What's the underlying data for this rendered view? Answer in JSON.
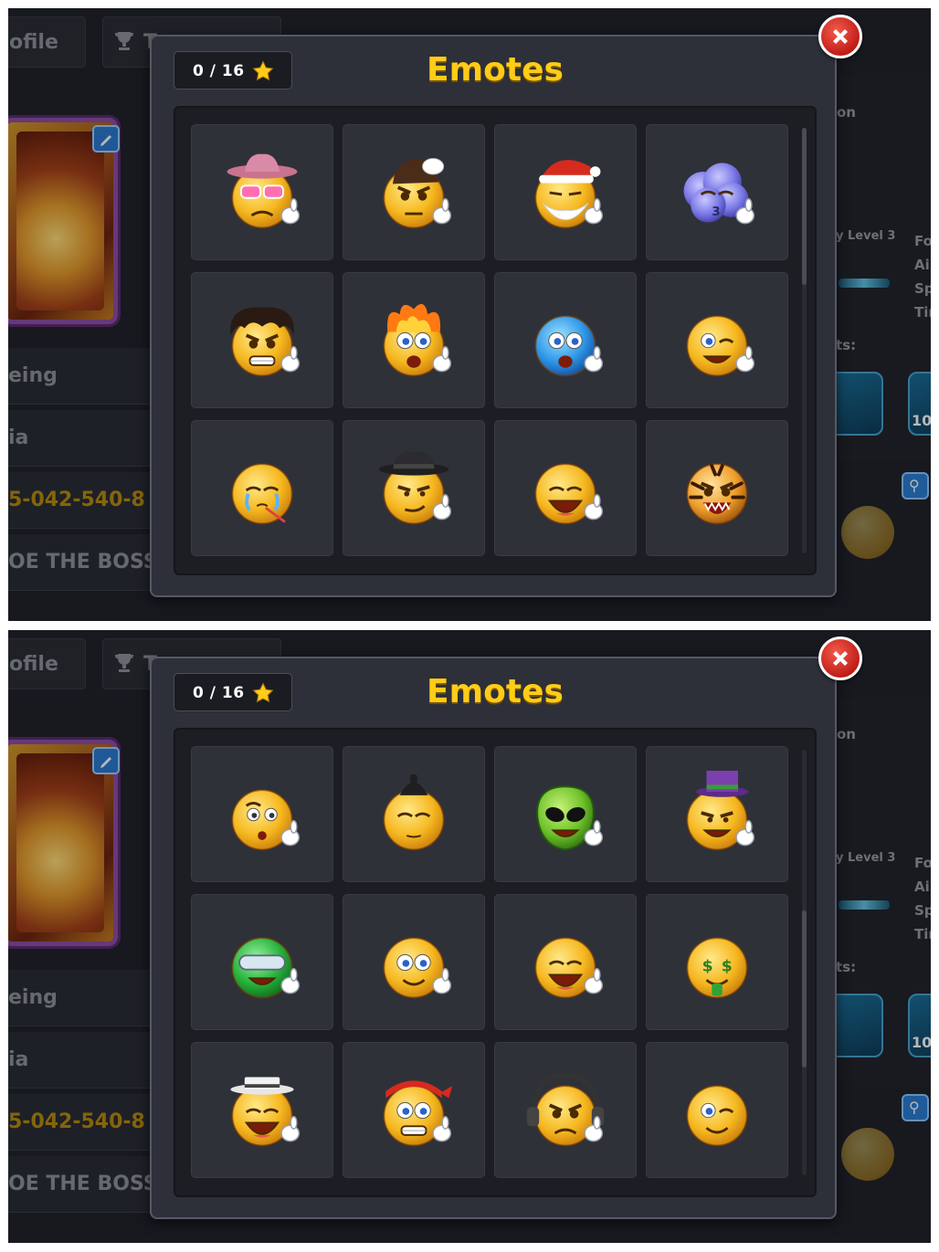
{
  "background": {
    "tabs": [
      {
        "label": "ofile"
      },
      {
        "label": "T"
      }
    ],
    "rows": [
      "eing",
      "ia",
      "5-042-540-8",
      "OE THE BOSS"
    ],
    "right_column": {
      "header": "on",
      "level": "y Level 3",
      "stats": [
        "Fo",
        "Ai",
        "Sp",
        "Tir"
      ],
      "achievements": "ts:",
      "card_label": "10"
    }
  },
  "screens": [
    {
      "title": "Emotes",
      "counter": "0 / 16",
      "scroll_thumb_pos": 0.0,
      "emotes": [
        {
          "name": "cowboy-sunglasses-emote",
          "hat": "cowboy",
          "eyes": "heart-glasses",
          "mouth": "frown",
          "hand": true
        },
        {
          "name": "snooker-ball-8-emote",
          "hat": "hair-wrap",
          "eyes": "angry",
          "mouth": "flat",
          "hand": true
        },
        {
          "name": "santa-emote",
          "hat": "santa",
          "eyes": "squint",
          "mouth": "beard",
          "hand": true
        },
        {
          "name": "cloud-pinwheel-emote",
          "face": "cloud",
          "eyes": "closed",
          "mouth": "kiss",
          "hand": true
        },
        {
          "name": "messy-hair-8-ball-emote",
          "hat": "messy-hair",
          "eyes": "angry",
          "mouth": "grimace",
          "hand": true
        },
        {
          "name": "on-fire-emote",
          "hat": "fire",
          "eyes": "wide",
          "mouth": "open",
          "hand": true
        },
        {
          "name": "frozen-blue-emote",
          "face": "blue",
          "eyes": "wide",
          "mouth": "open",
          "hand": true
        },
        {
          "name": "chalk-cue-wink-emote",
          "eyes": "wink",
          "mouth": "grin",
          "hand": true
        },
        {
          "name": "crying-thermometer-emote",
          "eyes": "crying",
          "mouth": "thermometer",
          "hand": false
        },
        {
          "name": "gangster-fedora-emote",
          "hat": "fedora",
          "eyes": "sly",
          "mouth": "smirk",
          "hand": true
        },
        {
          "name": "pizza-laugh-emote",
          "eyes": "closed",
          "mouth": "laugh",
          "hand": true
        },
        {
          "name": "tiger-emote",
          "face": "tiger",
          "eyes": "angry",
          "mouth": "roar",
          "hand": false
        }
      ]
    },
    {
      "title": "Emotes",
      "counter": "0 / 16",
      "scroll_thumb_pos": 0.6,
      "emotes": [
        {
          "name": "soccer-ball-emote",
          "eyes": "raised",
          "mouth": "o",
          "hand": true
        },
        {
          "name": "samurai-emote",
          "hat": "samurai",
          "eyes": "closed",
          "mouth": "calm",
          "hand": false
        },
        {
          "name": "alien-emote",
          "face": "alien",
          "eyes": "alien",
          "mouth": "grin",
          "hand": true
        },
        {
          "name": "top-hat-vampire-emote",
          "hat": "top-hat",
          "eyes": "sly",
          "mouth": "grin",
          "hand": true
        },
        {
          "name": "green-helmet-peace-emote",
          "face": "green-helmet",
          "eyes": "visor",
          "mouth": "grin",
          "hand": true
        },
        {
          "name": "bowtie-cue-emote",
          "eyes": "wide",
          "mouth": "smile",
          "hand": true
        },
        {
          "name": "magic-hat-bunny-emote",
          "eyes": "closed",
          "mouth": "laugh",
          "hand": true
        },
        {
          "name": "money-eyes-emote",
          "eyes": "dollar",
          "mouth": "tongue",
          "hand": false
        },
        {
          "name": "tambourine-hat-emote",
          "hat": "boater",
          "eyes": "closed",
          "mouth": "laugh",
          "hand": true
        },
        {
          "name": "red-bandana-scared-emote",
          "hat": "bandana",
          "eyes": "wide",
          "mouth": "grimace",
          "hand": true
        },
        {
          "name": "headphones-emote",
          "hat": "headphones",
          "eyes": "angry",
          "mouth": "frown",
          "hand": true
        },
        {
          "name": "wink-emote",
          "eyes": "wink",
          "mouth": "smile",
          "hand": false
        }
      ]
    }
  ],
  "colors": {
    "title": "#ffcc17",
    "emote_yellow": "#f6b820",
    "close_red": "#d8281e",
    "cell_bg": "#2f3139",
    "frame_bg": "#1c1e24"
  }
}
